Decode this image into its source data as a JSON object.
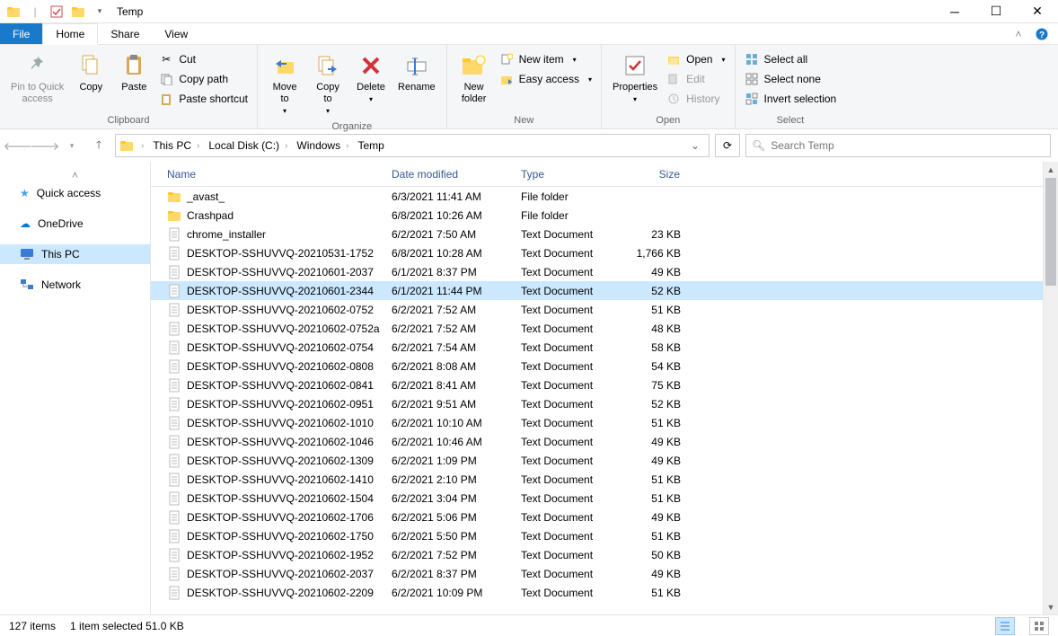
{
  "window": {
    "title": "Temp"
  },
  "tabs": {
    "file": "File",
    "home": "Home",
    "share": "Share",
    "view": "View"
  },
  "ribbon": {
    "clipboard": {
      "label": "Clipboard",
      "pin": "Pin to Quick\naccess",
      "copy": "Copy",
      "paste": "Paste",
      "cut": "Cut",
      "copypath": "Copy path",
      "pasteshortcut": "Paste shortcut"
    },
    "organize": {
      "label": "Organize",
      "moveto": "Move\nto",
      "copyto": "Copy\nto",
      "delete": "Delete",
      "rename": "Rename"
    },
    "new": {
      "label": "New",
      "newfolder": "New\nfolder",
      "newitem": "New item",
      "easyaccess": "Easy access"
    },
    "open": {
      "label": "Open",
      "properties": "Properties",
      "open": "Open",
      "edit": "Edit",
      "history": "History"
    },
    "select": {
      "label": "Select",
      "selectall": "Select all",
      "selectnone": "Select none",
      "invert": "Invert selection"
    }
  },
  "breadcrumb": [
    "This PC",
    "Local Disk (C:)",
    "Windows",
    "Temp"
  ],
  "search": {
    "placeholder": "Search Temp"
  },
  "columns": {
    "name": "Name",
    "date": "Date modified",
    "type": "Type",
    "size": "Size"
  },
  "sidebar": {
    "quick": "Quick access",
    "onedrive": "OneDrive",
    "thispc": "This PC",
    "network": "Network"
  },
  "files": [
    {
      "icon": "folder",
      "name": "_avast_",
      "date": "6/3/2021 11:41 AM",
      "type": "File folder",
      "size": "",
      "selected": false
    },
    {
      "icon": "folder",
      "name": "Crashpad",
      "date": "6/8/2021 10:26 AM",
      "type": "File folder",
      "size": "",
      "selected": false
    },
    {
      "icon": "text",
      "name": "chrome_installer",
      "date": "6/2/2021 7:50 AM",
      "type": "Text Document",
      "size": "23 KB",
      "selected": false
    },
    {
      "icon": "text",
      "name": "DESKTOP-SSHUVVQ-20210531-1752",
      "date": "6/8/2021 10:28 AM",
      "type": "Text Document",
      "size": "1,766 KB",
      "selected": false
    },
    {
      "icon": "text",
      "name": "DESKTOP-SSHUVVQ-20210601-2037",
      "date": "6/1/2021 8:37 PM",
      "type": "Text Document",
      "size": "49 KB",
      "selected": false
    },
    {
      "icon": "text",
      "name": "DESKTOP-SSHUVVQ-20210601-2344",
      "date": "6/1/2021 11:44 PM",
      "type": "Text Document",
      "size": "52 KB",
      "selected": true
    },
    {
      "icon": "text",
      "name": "DESKTOP-SSHUVVQ-20210602-0752",
      "date": "6/2/2021 7:52 AM",
      "type": "Text Document",
      "size": "51 KB",
      "selected": false
    },
    {
      "icon": "text",
      "name": "DESKTOP-SSHUVVQ-20210602-0752a",
      "date": "6/2/2021 7:52 AM",
      "type": "Text Document",
      "size": "48 KB",
      "selected": false
    },
    {
      "icon": "text",
      "name": "DESKTOP-SSHUVVQ-20210602-0754",
      "date": "6/2/2021 7:54 AM",
      "type": "Text Document",
      "size": "58 KB",
      "selected": false
    },
    {
      "icon": "text",
      "name": "DESKTOP-SSHUVVQ-20210602-0808",
      "date": "6/2/2021 8:08 AM",
      "type": "Text Document",
      "size": "54 KB",
      "selected": false
    },
    {
      "icon": "text",
      "name": "DESKTOP-SSHUVVQ-20210602-0841",
      "date": "6/2/2021 8:41 AM",
      "type": "Text Document",
      "size": "75 KB",
      "selected": false
    },
    {
      "icon": "text",
      "name": "DESKTOP-SSHUVVQ-20210602-0951",
      "date": "6/2/2021 9:51 AM",
      "type": "Text Document",
      "size": "52 KB",
      "selected": false
    },
    {
      "icon": "text",
      "name": "DESKTOP-SSHUVVQ-20210602-1010",
      "date": "6/2/2021 10:10 AM",
      "type": "Text Document",
      "size": "51 KB",
      "selected": false
    },
    {
      "icon": "text",
      "name": "DESKTOP-SSHUVVQ-20210602-1046",
      "date": "6/2/2021 10:46 AM",
      "type": "Text Document",
      "size": "49 KB",
      "selected": false
    },
    {
      "icon": "text",
      "name": "DESKTOP-SSHUVVQ-20210602-1309",
      "date": "6/2/2021 1:09 PM",
      "type": "Text Document",
      "size": "49 KB",
      "selected": false
    },
    {
      "icon": "text",
      "name": "DESKTOP-SSHUVVQ-20210602-1410",
      "date": "6/2/2021 2:10 PM",
      "type": "Text Document",
      "size": "51 KB",
      "selected": false
    },
    {
      "icon": "text",
      "name": "DESKTOP-SSHUVVQ-20210602-1504",
      "date": "6/2/2021 3:04 PM",
      "type": "Text Document",
      "size": "51 KB",
      "selected": false
    },
    {
      "icon": "text",
      "name": "DESKTOP-SSHUVVQ-20210602-1706",
      "date": "6/2/2021 5:06 PM",
      "type": "Text Document",
      "size": "49 KB",
      "selected": false
    },
    {
      "icon": "text",
      "name": "DESKTOP-SSHUVVQ-20210602-1750",
      "date": "6/2/2021 5:50 PM",
      "type": "Text Document",
      "size": "51 KB",
      "selected": false
    },
    {
      "icon": "text",
      "name": "DESKTOP-SSHUVVQ-20210602-1952",
      "date": "6/2/2021 7:52 PM",
      "type": "Text Document",
      "size": "50 KB",
      "selected": false
    },
    {
      "icon": "text",
      "name": "DESKTOP-SSHUVVQ-20210602-2037",
      "date": "6/2/2021 8:37 PM",
      "type": "Text Document",
      "size": "49 KB",
      "selected": false
    },
    {
      "icon": "text",
      "name": "DESKTOP-SSHUVVQ-20210602-2209",
      "date": "6/2/2021 10:09 PM",
      "type": "Text Document",
      "size": "51 KB",
      "selected": false
    }
  ],
  "status": {
    "count": "127 items",
    "selected": "1 item selected  51.0 KB"
  }
}
